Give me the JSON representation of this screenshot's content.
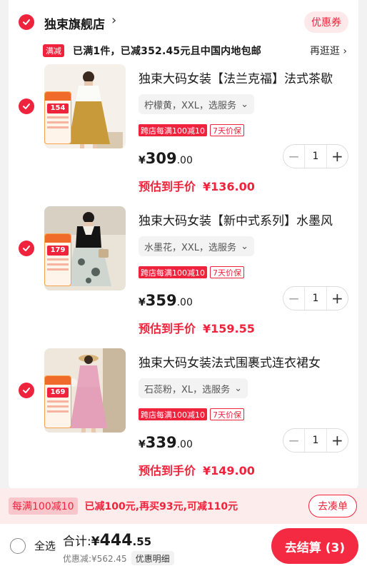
{
  "shop": {
    "name": "独束旗舰店",
    "arrow": "›",
    "coupon_label": "优惠券"
  },
  "promo": {
    "tag": "满减",
    "text": "已满1件，已减352.45元且中国内地包邮",
    "link": "再逛逛 ›"
  },
  "items": [
    {
      "title": "独束大码女装【法兰克福】法式茶歇",
      "sku": "柠檬黄，XXL，选服务",
      "badge_price": "154",
      "tag_cross": "跨店每满100减10",
      "tag_return": "7天价保",
      "price_cur": "¥",
      "price_int": "309",
      "price_dec": ".00",
      "quantity": "1",
      "est_label": "预估到手价",
      "est_price": "¥136.00"
    },
    {
      "title": "独束大码女装【新中式系列】水墨风",
      "sku": "水墨花，XXL，选服务",
      "badge_price": "179",
      "tag_cross": "跨店每满100减10",
      "tag_return": "7天价保",
      "price_cur": "¥",
      "price_int": "359",
      "price_dec": ".00",
      "quantity": "1",
      "est_label": "预估到手价",
      "est_price": "¥159.55"
    },
    {
      "title": "独束大码女装法式围裹式连衣裙女",
      "sku": "石蕊粉，XL，选服务",
      "badge_price": "169",
      "tag_cross": "跨店每满100减10",
      "tag_return": "7天价保",
      "price_cur": "¥",
      "price_int": "339",
      "price_dec": ".00",
      "quantity": "1",
      "est_label": "预估到手价",
      "est_price": "¥149.00"
    }
  ],
  "stepper": {
    "minus": "−",
    "plus": "+"
  },
  "sku_chevron": "⌄",
  "promo_bar": {
    "tag": "每满100减10",
    "text": "已减100元,再买93元,可减110元",
    "button": "去凑单"
  },
  "footer": {
    "select_all": "全选",
    "total_label": "合计:",
    "total_cur": "¥",
    "total_int": "444",
    "total_dec": ".55",
    "discount": "优惠减:¥562.45",
    "detail_btn": "优惠明细",
    "checkout": "去结算 (3)"
  },
  "colors": {
    "accent": "#f0233c",
    "background": "#f2f2f2",
    "promo_bar_bg": "#fdecec"
  },
  "icons": [
    "check-icon",
    "chevron-right-icon",
    "chevron-down-icon",
    "minus-icon",
    "plus-icon",
    "radio-icon"
  ]
}
